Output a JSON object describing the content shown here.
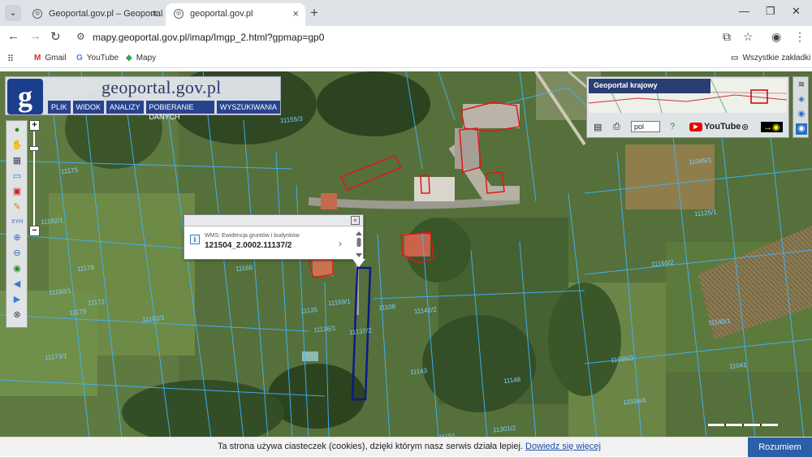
{
  "browser": {
    "tabs": [
      {
        "title": "Geoportal.gov.pl – Geoportal Inf",
        "active": false
      },
      {
        "title": "geoportal.gov.pl",
        "active": true
      }
    ],
    "url": "mapy.geoportal.gov.pl/imap/Imgp_2.html?gpmap=gp0",
    "bookmarks": [
      {
        "label": "Gmail",
        "icon": "gmail-icon"
      },
      {
        "label": "YouTube",
        "icon": "google-icon"
      },
      {
        "label": "Mapy",
        "icon": "maps-icon"
      }
    ],
    "all_bookmarks": "Wszystkie zakładki"
  },
  "geoportal": {
    "logo_letter": "g",
    "title": "geoportal.gov.pl",
    "menu": [
      "PLIK",
      "WIDOK",
      "ANALIZY",
      "POBIERANIE DANYCH",
      "WYSZUKIWANIA"
    ]
  },
  "overview": {
    "title": "Geoportal krajowy",
    "language": "pol",
    "youtube": "YouTube"
  },
  "popup": {
    "source": "WMS: Ewidencja gruntów i budynków",
    "value": "121504_2.0002.11137/2"
  },
  "parcels": [
    {
      "label": "11157/1"
    },
    {
      "label": "11156/1"
    },
    {
      "label": "11155/3"
    },
    {
      "label": "11175"
    },
    {
      "label": "11182/1"
    },
    {
      "label": "11178"
    },
    {
      "label": "11180/1"
    },
    {
      "label": "11179"
    },
    {
      "label": "11173/1"
    },
    {
      "label": "11135"
    },
    {
      "label": "11136/1"
    },
    {
      "label": "11137/2"
    },
    {
      "label": "11108"
    },
    {
      "label": "11142/2"
    },
    {
      "label": "11148"
    },
    {
      "label": "11143"
    },
    {
      "label": "11151"
    },
    {
      "label": "11045/1"
    },
    {
      "label": "11160/2"
    },
    {
      "label": "11140/1"
    },
    {
      "label": "11035/3"
    },
    {
      "label": "11041"
    },
    {
      "label": "11036/4"
    },
    {
      "label": "11301/2"
    },
    {
      "label": "11125/1"
    },
    {
      "label": "11159/1"
    },
    {
      "label": "11166"
    },
    {
      "label": "11162/1"
    },
    {
      "label": "11172"
    }
  ],
  "cookie": {
    "text": "Ta strona używa ciasteczek (cookies), dzięki którym nasz serwis działa lepiej.",
    "link": "Dowiedz się więcej",
    "button": "Rozumiem"
  }
}
